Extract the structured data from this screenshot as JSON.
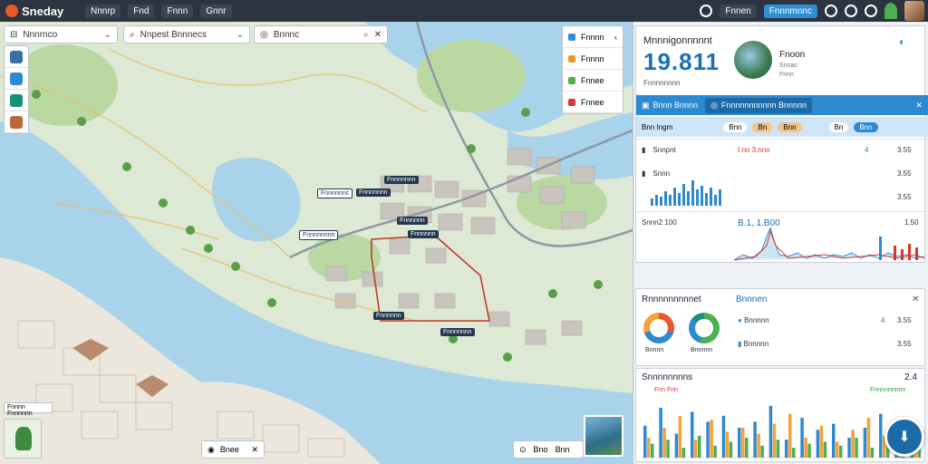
{
  "topbar": {
    "app_name": "Sneday",
    "nav": [
      "Nnnrp",
      "Fnd",
      "Fnnn",
      "Gnnr"
    ],
    "right_pill_1": "Fnnen",
    "right_pill_2": "Fnnnmnnc",
    "accent": "#2f8fd6"
  },
  "map": {
    "search_1": "Nnnrnco",
    "search_2": "Nnpest Bnnnecs",
    "search_3": "Bnnnc",
    "layers": [
      {
        "label": "Fnnnn",
        "color": "#2f8fd6"
      },
      {
        "label": "Fnnnn",
        "color": "#e89a2a"
      },
      {
        "label": "Fnnee",
        "color": "#4caf50"
      },
      {
        "label": "Fnnee",
        "color": "#d33b3b"
      }
    ],
    "labels": [
      "Fnnnnnnn",
      "Fnnnnnnc",
      "Fnnnnnnn",
      "Fnnnnnn",
      "Fnnnnnnnn",
      "Fnnnnnn",
      "Fnnnnnn",
      "Fnnnnnnn"
    ],
    "zoom_label": "Bnee",
    "scale_a": "Bno",
    "scale_b": "Bnn",
    "bottom_left": "Fnnnn Fnnnnnn"
  },
  "panel": {
    "header_title": "Mnnnigonnnnnt",
    "header_value": "19.811",
    "header_sub": "Fnnnnnnnn",
    "photo_title": "Fnoon",
    "photo_sub": "Snnac",
    "photo_sub2": "Fnnn",
    "tab_1": "Bnnn Bnnnn",
    "tab_2": "Fnnnnnnnnnnn Bnnnnn",
    "filters": [
      "Bnn Ingm",
      "Bnn",
      "Bn",
      "Bnn",
      "Bn",
      "Bnn"
    ],
    "rows": [
      {
        "label": "Snnpnt",
        "metric": "I.no 3.nno",
        "delta": "4",
        "value": "3.55"
      },
      {
        "label": "Snnn",
        "metric": "",
        "delta": "",
        "value": "3.55"
      },
      {
        "label": "",
        "metric": "",
        "delta": "",
        "value": "3.55"
      },
      {
        "label": "Snnn2 100",
        "metric": "B.1, 1.B00",
        "delta": "",
        "value": "1.50"
      }
    ],
    "section2_title": "Rnnnnnnnnnet",
    "section2_link": "Bnnnen",
    "donut_1": "Bnnnn",
    "donut_2": "Bnnnnn",
    "s2_rows": [
      {
        "label": "Bnnnnn",
        "delta": "4",
        "value": "3.55"
      },
      {
        "label": "Bnnnnn",
        "delta": "",
        "value": "3.55"
      }
    ],
    "section3_title": "Snnnnnnnns",
    "section3_value": "2.4",
    "section3_left": "Fnn Fnn",
    "section3_right": "Fnnnnnnnnn"
  },
  "chart_data": {
    "type": "bar",
    "title": "Snnnnnnnns",
    "series": [
      {
        "name": "blue",
        "values": [
          32,
          50,
          24,
          46,
          36,
          42,
          30,
          36,
          52,
          18,
          40,
          28,
          34,
          20,
          30,
          44,
          26,
          38
        ]
      },
      {
        "name": "orange",
        "values": [
          20,
          30,
          42,
          18,
          38,
          26,
          30,
          24,
          34,
          44,
          20,
          32,
          16,
          28,
          40,
          22,
          30,
          26
        ]
      },
      {
        "name": "green",
        "values": [
          14,
          18,
          10,
          22,
          12,
          16,
          20,
          12,
          18,
          10,
          14,
          16,
          12,
          20,
          10,
          18,
          14,
          12
        ]
      }
    ],
    "ylim": [
      0,
      60
    ]
  }
}
